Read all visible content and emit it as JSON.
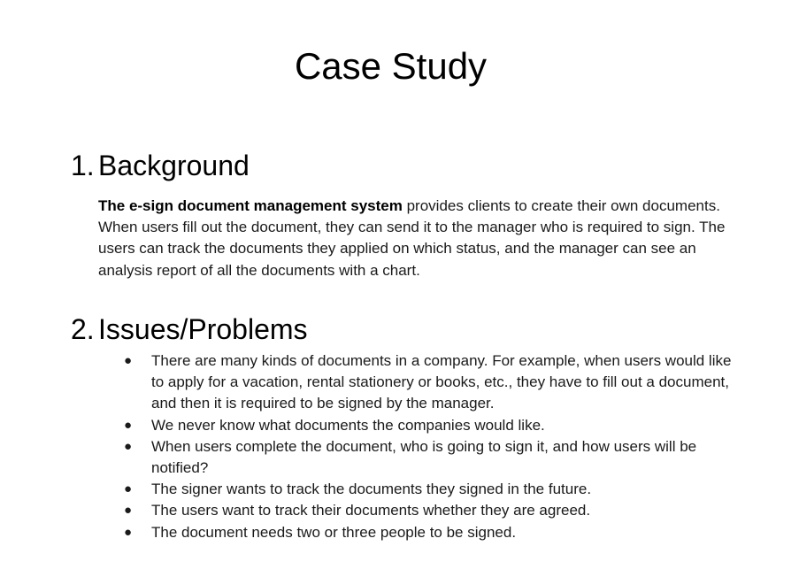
{
  "document": {
    "title": "Case Study"
  },
  "sections": [
    {
      "number": "1.",
      "heading": "Background",
      "paragraph": {
        "bold_lead": "The e-sign document management system",
        "text": " provides clients to create their own documents. When users fill out the document, they can send it to the manager who is required to sign. The users can track the documents they applied on which status, and the manager can see an analysis report of all the documents with a chart."
      }
    },
    {
      "number": "2.",
      "heading": "Issues/Problems",
      "bullet_symbol": "●",
      "items": [
        "There are many kinds of documents in a company. For example, when users would like to apply for a vacation, rental stationery or books, etc., they have to fill out a document, and then it is required to be signed by the manager.",
        "We never know what documents the companies would like.",
        "When users complete the document, who is going to sign it, and how users will be notified?",
        "The signer wants to track the documents they signed in the future.",
        "The users want to track their documents whether they are agreed.",
        "The document needs two or three people to be signed."
      ]
    }
  ]
}
